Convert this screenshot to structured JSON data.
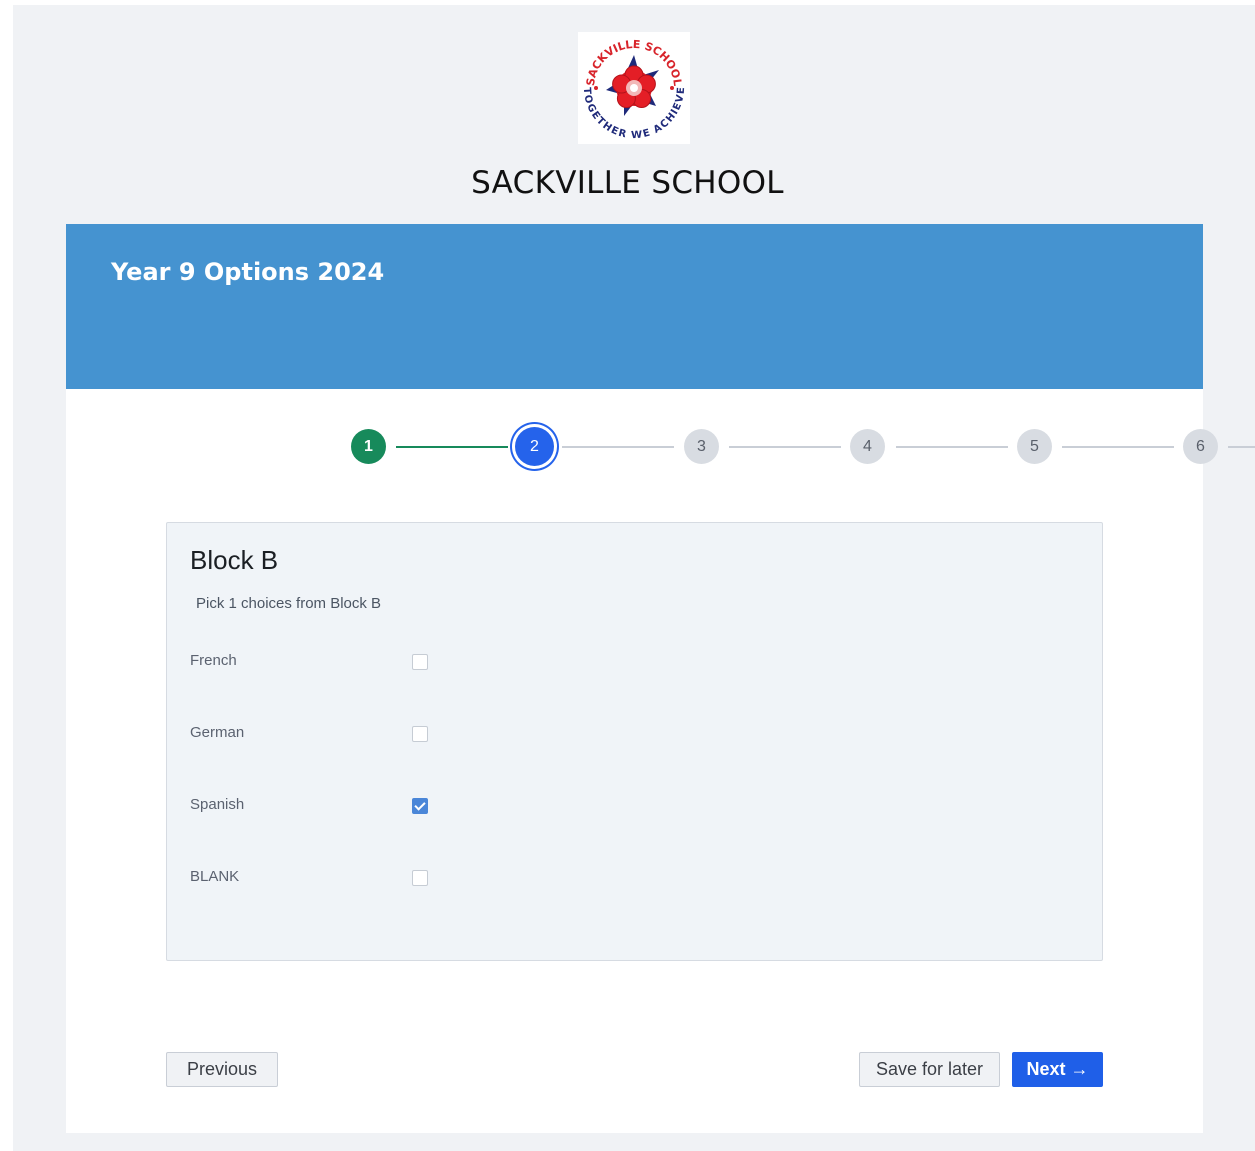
{
  "school": {
    "name": "SACKVILLE SCHOOL",
    "logo_text": [
      "SACKVILLE SCHOOL",
      "TOGETHER WE ACHIEVE"
    ]
  },
  "form": {
    "title": "Year 9 Options 2024"
  },
  "stepper": {
    "steps": [
      {
        "label": "1",
        "state": "completed"
      },
      {
        "label": "2",
        "state": "current"
      },
      {
        "label": "3",
        "state": "upcoming"
      },
      {
        "label": "4",
        "state": "upcoming"
      },
      {
        "label": "5",
        "state": "upcoming"
      },
      {
        "label": "6",
        "state": "upcoming"
      }
    ]
  },
  "block": {
    "title": "Block B",
    "instructions": "Pick 1 choices from Block B",
    "options": [
      {
        "label": "French",
        "checked": false
      },
      {
        "label": "German",
        "checked": false
      },
      {
        "label": "Spanish",
        "checked": true
      },
      {
        "label": "BLANK",
        "checked": false
      }
    ]
  },
  "buttons": {
    "previous": "Previous",
    "save": "Save for later",
    "next": "Next →"
  },
  "colors": {
    "header": "#4593d0",
    "completed_step": "#178a5b",
    "current_step": "#2563eb",
    "primary_button": "#1f5fe8",
    "checkbox_checked": "#4a86d8"
  }
}
